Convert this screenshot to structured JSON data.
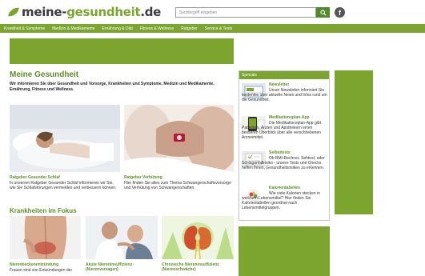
{
  "header": {
    "logo": {
      "part1": "meine-",
      "part2": "gesundheit",
      "part3": ".de"
    },
    "search_placeholder": "Suchbegriff eingeben",
    "facebook_label": "f"
  },
  "nav": [
    "Krankheit & Symptome",
    "Medizin & Medikamente",
    "Ernährung & Diät",
    "Fitness & Wellness",
    "Ratgeber",
    "Service & Tests"
  ],
  "main": {
    "title": "Meine Gesundheit",
    "intro": "Wir informieren Sie über Gesundheit und Vorsorge, Krankheiten und Symptome, Medizin und Medikamente, Ernährung, Fitness und Wellness.",
    "teasers": [
      {
        "title": "Ratgeber Gesunder Schlaf",
        "text": "In unserem Ratgeber Gesunder Schlaf informieren wir Sie, wie Sie Schlafstörungen vermeiden und verbessern können."
      },
      {
        "title": "Ratgeber Verhütung",
        "text": "Hier finden Sie alles zum Thema Schwangerschaftsvorsorge und Verhütung von Schwangerschaften."
      }
    ],
    "section_title": "Krankheiten im Fokus",
    "focus": [
      {
        "title": "Nierenbeckenentzündung",
        "text": "Frauen sind von Entzündungen der"
      },
      {
        "title": "Akute Niereninsuffizienz (Nierenversagen)"
      },
      {
        "title": "Chronische Niereninsuffizienz (Nierenschwäche)"
      }
    ]
  },
  "specials": {
    "heading": "Specials",
    "items": [
      {
        "title": "Newsletter",
        "text": "Unser Newsletter informiert Sie kostenlos über aktuelle News und Infos rund um die Gesundheit."
      },
      {
        "title": "Medikationsplan-App",
        "text": "Die Medikationsplan-App gibt Patienten, Ärzten und Apothekern einen besseren Überblick über alle verschriebenen Arzneimittel."
      },
      {
        "title": "Selbsttests",
        "text": "Ob BMI-Rechner, Sehtest, oder Schlaganfallrisiko - unsere Tests und Checks helfen Ihnen, Gesundheitsrisiken zu erkennen."
      },
      {
        "title": "Kalorientabellen",
        "text": "Wie viele Kalorien stecken in welchem Lebensmittel? Hier finden Sie Kalorientabellen geordnet nach Lebensmittelgruppen."
      }
    ]
  },
  "colors": {
    "brand_green": "#7ba52e",
    "title_green": "#5d8f25",
    "search_button": "#4f8a2b"
  }
}
